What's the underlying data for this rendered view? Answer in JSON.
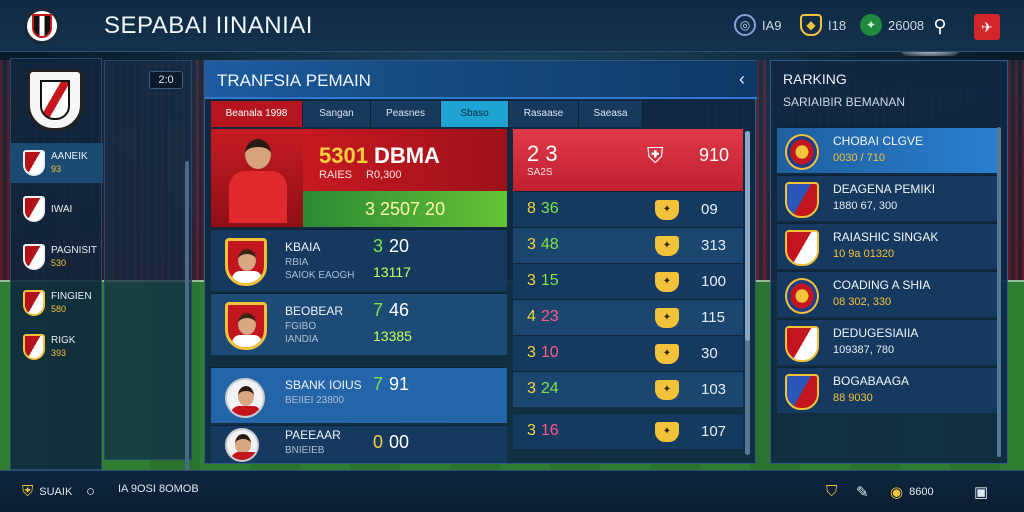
{
  "header": {
    "title": "SEPABAI IINANIAI",
    "stats": [
      {
        "icon": "globe-icon",
        "value": "IA9"
      },
      {
        "icon": "shield-icon",
        "value": "I18"
      },
      {
        "icon": "coin-icon",
        "value": "26008"
      }
    ]
  },
  "sidebar": {
    "items": [
      {
        "label": "AANEIK",
        "sub": "93"
      },
      {
        "label": "IWAI",
        "sub": ""
      },
      {
        "label": "PAGNISIT",
        "sub": "530"
      },
      {
        "label": "FINGIEN",
        "sub": "580"
      },
      {
        "label": "RIGK",
        "sub": "393"
      }
    ]
  },
  "col2": {
    "pill": "2:0"
  },
  "main": {
    "title": "TRANFSIА PEMAIN",
    "tabs": [
      "Beanala 1998",
      "Sangan",
      "Peasnes",
      "Sbaso",
      "Rasaase",
      "Saeasa"
    ],
    "featured": {
      "value_yellow": "5301",
      "value_white": "DBMA",
      "sub1": "RAIES",
      "sub2": "R0,300",
      "green_value": "3 2507 20"
    },
    "players": [
      {
        "name": "KBAIA",
        "sub1": "RBIA",
        "sub2": "SAIOK EAOGH",
        "val1": "3",
        "val2": "20",
        "val3": "13117"
      },
      {
        "name": "BEOBEAR",
        "sub1": "FGIBO",
        "sub2": "IANDIA",
        "val1": "7",
        "val2": "46",
        "val3": "13385"
      },
      {
        "name": "SBANK IOIUS",
        "sub1": "BEIIEI 23800",
        "sub2": "",
        "val1": "7",
        "val2": "91",
        "val3": ""
      },
      {
        "name": "PAEEAAR",
        "sub1": "BNIEIEB",
        "sub2": "",
        "val1": "0",
        "val2": "00",
        "val3": ""
      }
    ],
    "stats_top": {
      "a": "2 3",
      "b": "SA2S",
      "c": "910"
    },
    "stats": [
      {
        "y": "8",
        "g": "36",
        "m": "",
        "b": "09"
      },
      {
        "y": "3",
        "g": "48",
        "m": "",
        "b": "313"
      },
      {
        "y": "3",
        "g": "15",
        "m": "",
        "b": "100"
      },
      {
        "y": "4",
        "g": "",
        "m": "23",
        "b": "115"
      },
      {
        "y": "3",
        "g": "",
        "m": "10",
        "b": "30"
      },
      {
        "y": "3",
        "g": "24",
        "m": "",
        "b": "103"
      },
      {
        "y": "3",
        "g": "",
        "m": "16",
        "b": "107"
      }
    ]
  },
  "ranking": {
    "title": "RARKING",
    "subtitle": "SARIAIBIR BEMANAN",
    "items": [
      {
        "name": "CHOBAI CLGVE",
        "val": "0030 / 710"
      },
      {
        "name": "DEAGENA PEMIKI",
        "val": "1880 67, 300"
      },
      {
        "name": "RAIASHIC SINGAK",
        "val": "10 9a 01320"
      },
      {
        "name": "COADING A SHIA",
        "val": "08 302, 330"
      },
      {
        "name": "DEDUGESIAIIA",
        "val": "109387, 780"
      },
      {
        "name": "BOGABAAGA",
        "val": "88 9030"
      }
    ]
  },
  "footer": {
    "left_label": "SUAIK",
    "center_label": "IA 9OSI 8OMOB",
    "right_value": "8600"
  }
}
